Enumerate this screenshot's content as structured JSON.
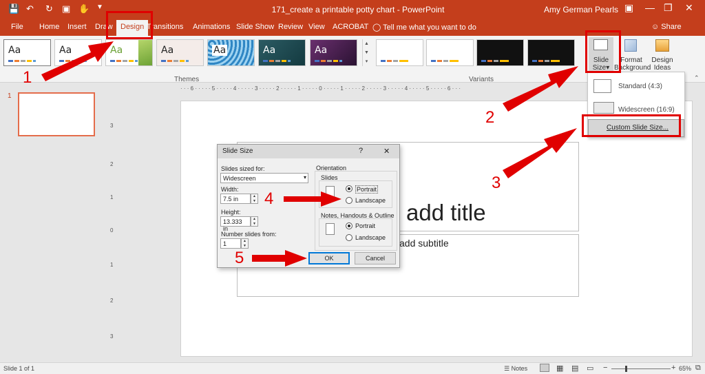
{
  "window": {
    "title": "171_create a printable potty chart  -  PowerPoint",
    "user": "Amy German Pearls"
  },
  "tabs": [
    {
      "label": "File",
      "active": false
    },
    {
      "label": "Home",
      "active": false
    },
    {
      "label": "Insert",
      "active": false
    },
    {
      "label": "Draw",
      "active": false
    },
    {
      "label": "Design",
      "active": true
    },
    {
      "label": "Transitions",
      "active": false
    },
    {
      "label": "Animations",
      "active": false
    },
    {
      "label": "Slide Show",
      "active": false
    },
    {
      "label": "Review",
      "active": false
    },
    {
      "label": "View",
      "active": false
    },
    {
      "label": "ACROBAT",
      "active": false
    }
  ],
  "tell_me": "Tell me what you want to do",
  "share": "Share",
  "ribbon": {
    "themes_label": "Themes",
    "variants_label": "Variants",
    "theme_sample": "Aa",
    "slide_size": {
      "line1": "Slide",
      "line2": "Size"
    },
    "format_background": {
      "line1": "Format",
      "line2": "Background"
    },
    "design_ideas": {
      "line1": "Design",
      "line2": "Ideas"
    }
  },
  "dropdown": {
    "items": [
      "Standard (4:3)",
      "Widescreen (16:9)",
      "Custom Slide Size..."
    ]
  },
  "thumbnail": {
    "number": "1"
  },
  "slide": {
    "title_partial": "add title",
    "subtitle_partial": "add subtitle"
  },
  "dialog": {
    "title": "Slide Size",
    "help": "?",
    "close": "✕",
    "sized_for_label": "Slides sized for:",
    "sized_for_value": "Widescreen",
    "width_label": "Width:",
    "width_value": "7.5 in",
    "height_label": "Height:",
    "height_value": "13.333 in",
    "number_from_label": "Number slides from:",
    "number_from_value": "1",
    "orientation_label": "Orientation",
    "slides_label": "Slides",
    "portrait": "Portrait",
    "landscape": "Landscape",
    "notes_label": "Notes, Handouts & Outline",
    "ok": "OK",
    "cancel": "Cancel"
  },
  "status": {
    "slide_count": "Slide 1 of 1",
    "notes": "Notes",
    "zoom": "65%"
  },
  "annotations": [
    "1",
    "2",
    "3",
    "4",
    "5"
  ],
  "colors": {
    "brand": "#c43e1c",
    "annotation": "#e00000"
  },
  "rulers": {
    "horizontal": "· · · 6 · · · · · 5 · · · · · 4 · · · · · 3 · · · · · 2 · · · · · 1 · · · · · 0 · · · · · 1 · · · · · 2 · · · · · 3 · · · · · 4 · · · · · 5 · · · · · 6 · · ·",
    "vertical": [
      "3",
      "2",
      "1",
      "0",
      "1",
      "2",
      "3"
    ]
  }
}
